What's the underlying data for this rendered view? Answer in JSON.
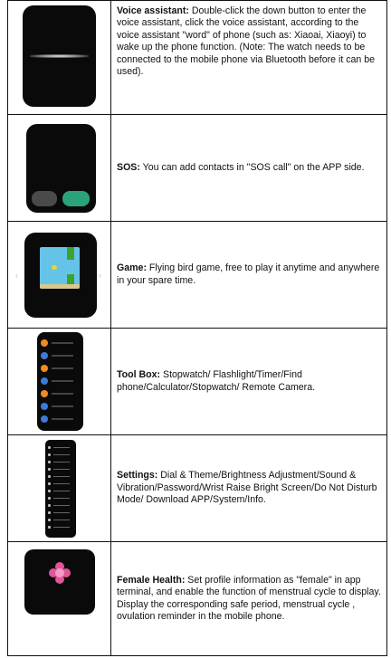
{
  "rows": [
    {
      "title": "Voice assistant:",
      "text": " Double-click the down button to enter the voice assistant, click the voice assistant, according to the voice assistant \"word\" of phone (such as: Xiaoai, Xiaoyi) to wake up the phone function. (Note: The watch needs to be connected to the mobile phone via Bluetooth before it can be used).",
      "icon": "voice-assistant-watch-icon"
    },
    {
      "title": "SOS:",
      "text": " You can add contacts in \"SOS call\" on the APP side.",
      "icon": "sos-watch-icon"
    },
    {
      "title": "Game:",
      "text": " Flying bird game, free to play it anytime and anywhere in your spare time.",
      "icon": "flying-bird-game-watch-icon"
    },
    {
      "title": "Tool Box:",
      "text": " Stopwatch/ Flashlight/Timer/Find phone/Calculator/Stopwatch/ Remote Camera.",
      "icon": "tool-box-watch-icon"
    },
    {
      "title": "Settings:",
      "text": " Dial & Theme/Brightness Adjustment/Sound & Vibration/Password/Wrist Raise Bright Screen/Do Not Disturb Mode/ Download APP/System/Info.",
      "icon": "settings-watch-icon"
    },
    {
      "title": "Female Health:",
      "text": " Set profile information as \"female\" in app terminal, and enable the function of menstrual cycle to display. Display the corresponding safe period, menstrual cycle , ovulation reminder in the mobile phone.",
      "icon": "female-health-watch-icon"
    }
  ],
  "colors": {
    "border": "#111111",
    "watch_bg": "#0a0a0a",
    "sos_cancel": "#4a4a4a",
    "sos_confirm": "#2aa37a",
    "game_sky": "#66c3e8",
    "flower": "#e2559a"
  }
}
